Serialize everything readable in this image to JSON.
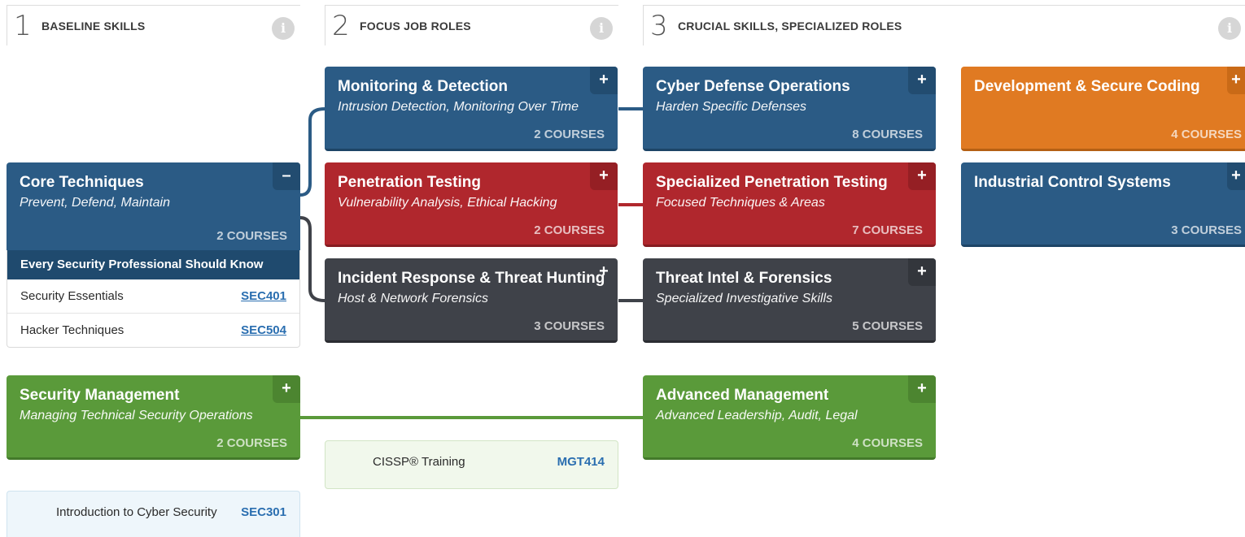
{
  "columns": [
    {
      "num": "1",
      "title": "BASELINE SKILLS"
    },
    {
      "num": "2",
      "title": "FOCUS JOB ROLES"
    },
    {
      "num": "3",
      "title": "CRUCIAL SKILLS, SPECIALIZED ROLES"
    }
  ],
  "info_glyph": "i",
  "colors": {
    "blue": "#2b5b85",
    "red": "#b0272d",
    "dark": "#3f4249",
    "green": "#5a9a3a",
    "orange": "#e07a22",
    "link": "#2a6eb0"
  },
  "cards": {
    "core": {
      "title": "Core Techniques",
      "sub": "Prevent, Defend, Maintain",
      "courses": "2 COURSES",
      "toggle": "–"
    },
    "monitoring": {
      "title": "Monitoring & Detection",
      "sub": "Intrusion Detection, Monitoring Over Time",
      "courses": "2 COURSES",
      "toggle": "+"
    },
    "pentest": {
      "title": "Penetration Testing",
      "sub": "Vulnerability Analysis, Ethical Hacking",
      "courses": "2 COURSES",
      "toggle": "+"
    },
    "incident": {
      "title": "Incident Response & Threat Hunting",
      "sub": "Host & Network Forensics",
      "courses": "3 COURSES",
      "toggle": "+"
    },
    "cyberdef": {
      "title": "Cyber Defense Operations",
      "sub": "Harden Specific Defenses",
      "courses": "8 COURSES",
      "toggle": "+"
    },
    "specpen": {
      "title": "Specialized Penetration Testing",
      "sub": "Focused Techniques & Areas",
      "courses": "7 COURSES",
      "toggle": "+"
    },
    "threatintel": {
      "title": "Threat Intel & Forensics",
      "sub": "Specialized Investigative Skills",
      "courses": "5 COURSES",
      "toggle": "+"
    },
    "devsec": {
      "title": "Development & Secure Coding",
      "sub": "",
      "courses": "4 COURSES",
      "toggle": "+"
    },
    "ics": {
      "title": "Industrial Control Systems",
      "sub": "",
      "courses": "3 COURSES",
      "toggle": "+"
    },
    "secmgmt": {
      "title": "Security Management",
      "sub": "Managing Technical Security Operations",
      "courses": "2 COURSES",
      "toggle": "+"
    },
    "advmgmt": {
      "title": "Advanced Management",
      "sub": "Advanced Leadership, Audit, Legal",
      "courses": "4 COURSES",
      "toggle": "+"
    }
  },
  "core_expanded": {
    "header": "Every Security Professional Should Know",
    "rows": [
      {
        "name": "Security Essentials",
        "code": "SEC401"
      },
      {
        "name": "Hacker Techniques",
        "code": "SEC504"
      }
    ]
  },
  "cissp": {
    "name": "CISSP® Training",
    "code": "MGT414"
  },
  "intro": {
    "name": "Introduction to Cyber Security",
    "code": "SEC301"
  }
}
